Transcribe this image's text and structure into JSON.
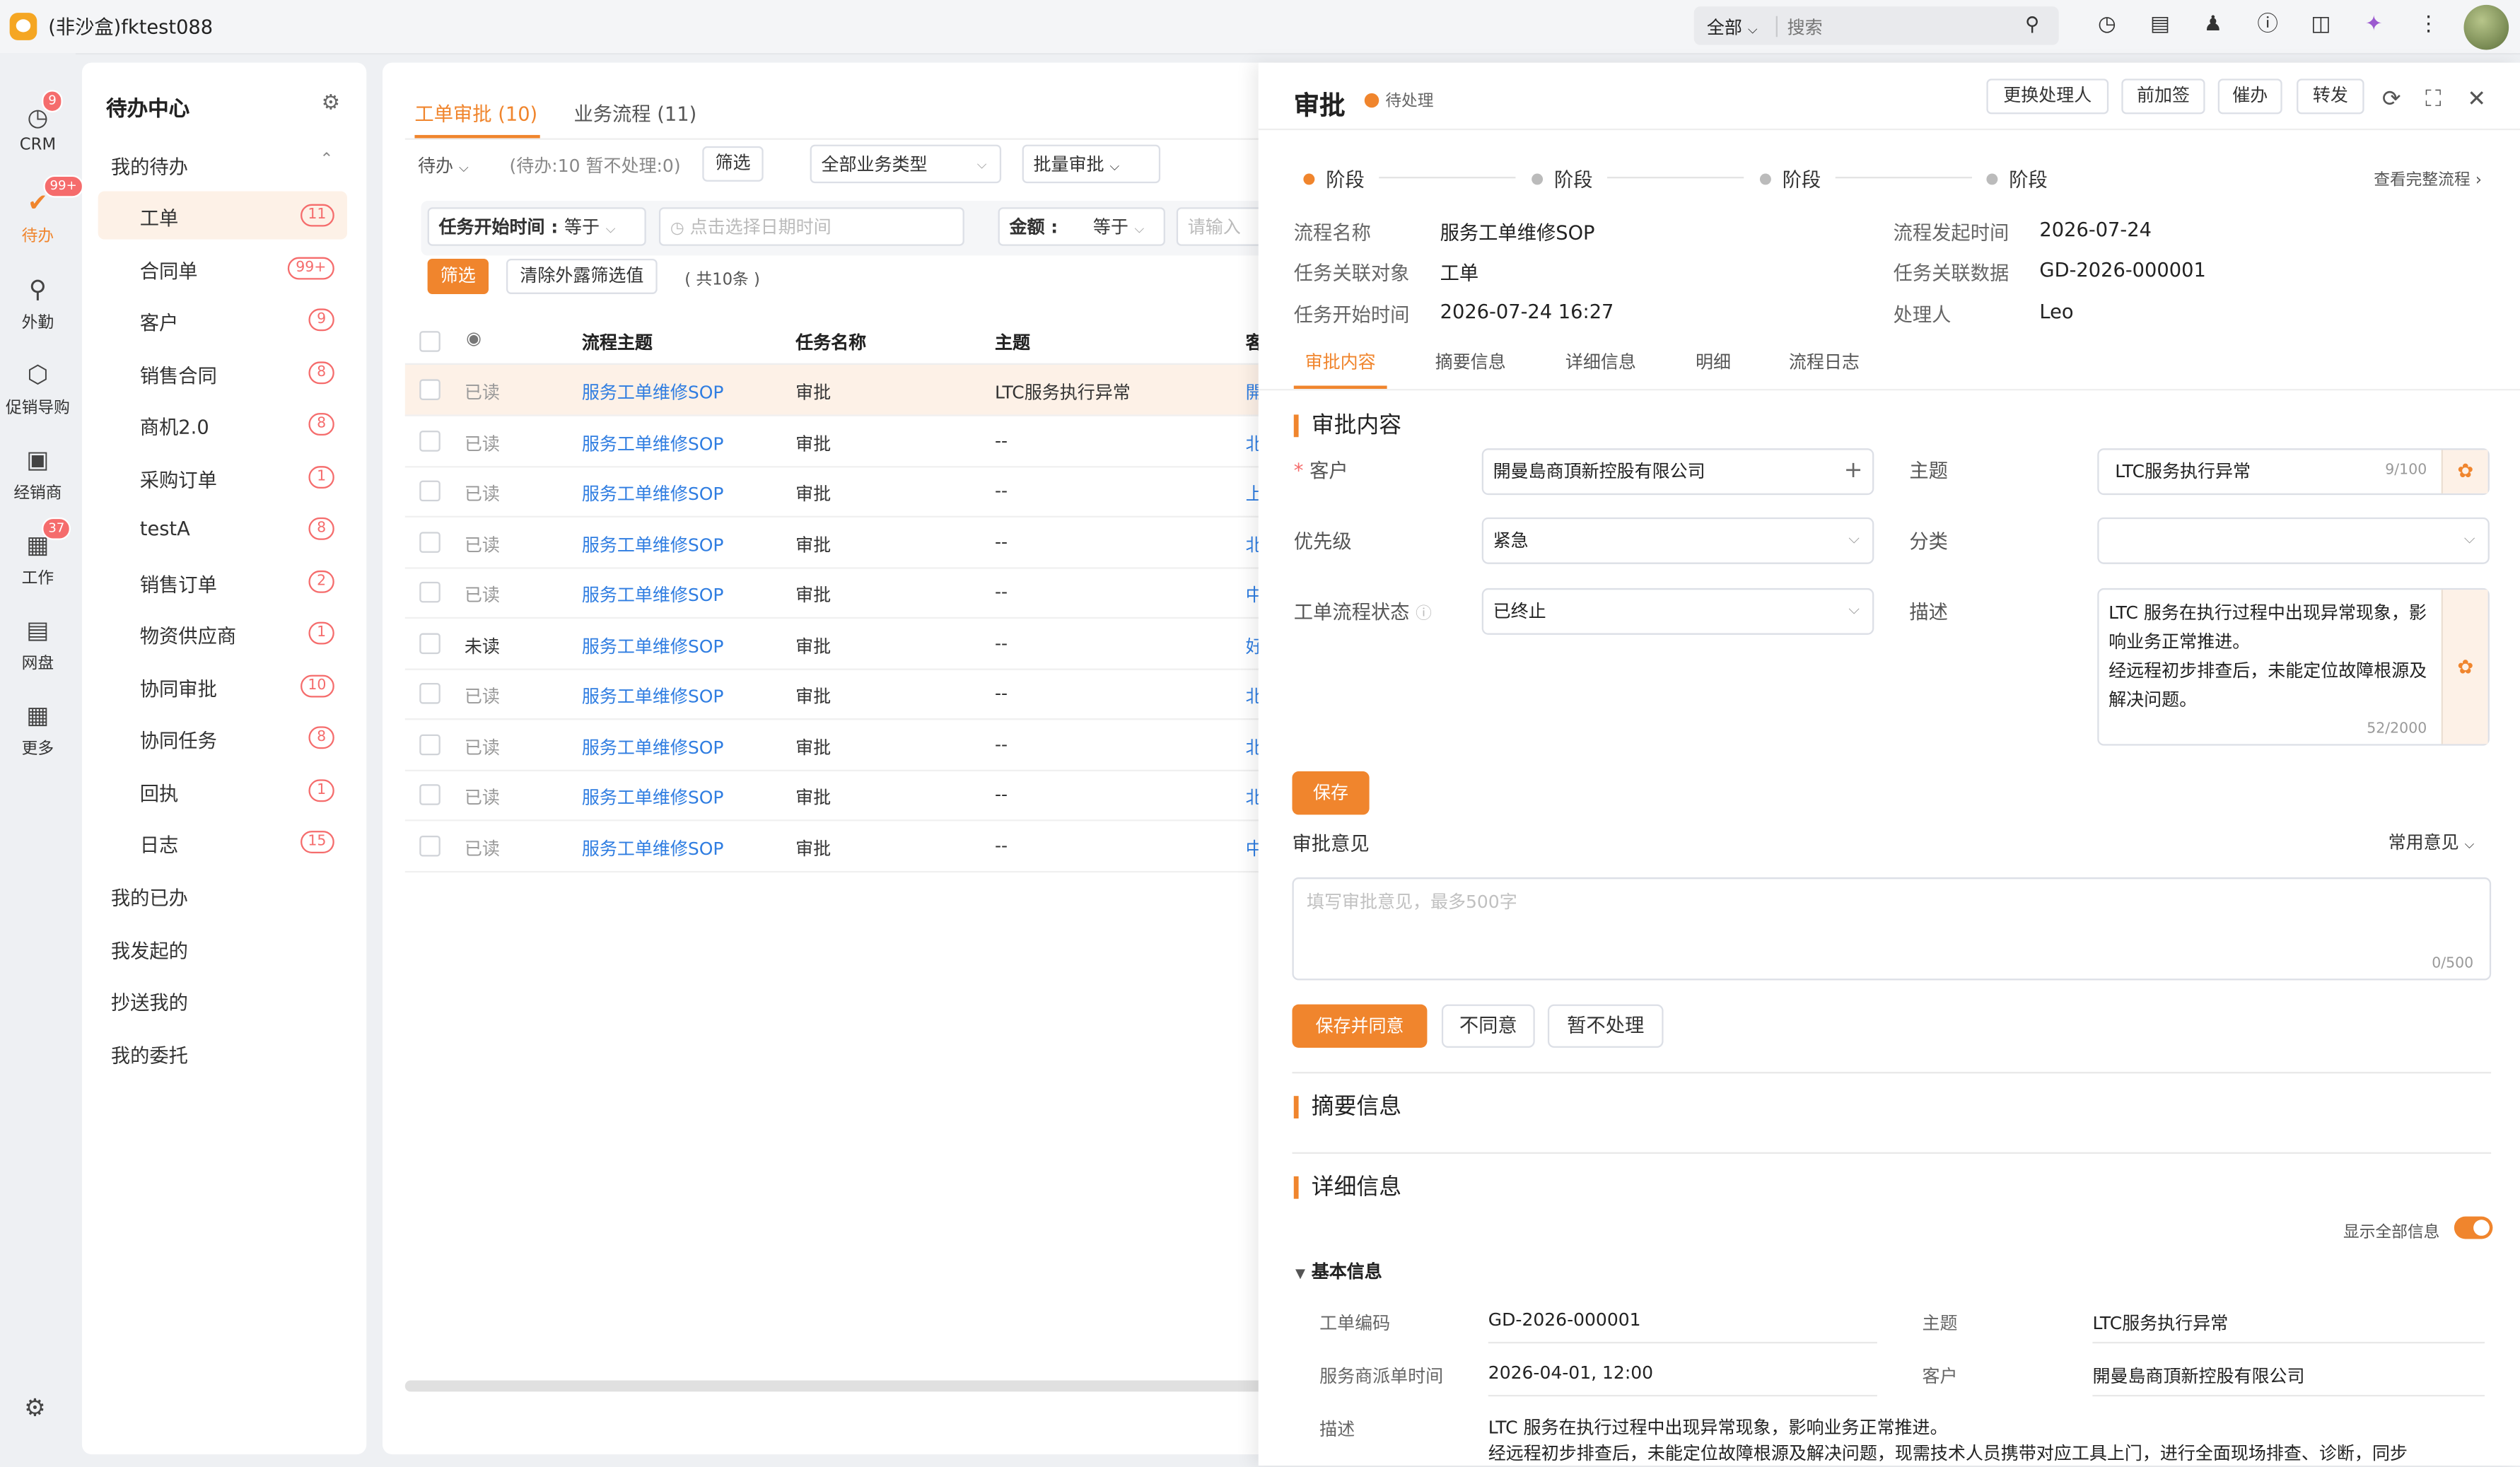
{
  "topbar": {
    "title": "(非沙盒)fktest088",
    "search_scope": "全部",
    "search_placeholder": "搜索"
  },
  "leftnav": [
    {
      "label": "CRM",
      "icon": "clock-icon",
      "badge": "9"
    },
    {
      "label": "待办",
      "icon": "check-circle-icon",
      "badge": "99+",
      "active": true
    },
    {
      "label": "外勤",
      "icon": "location-icon",
      "badge": ""
    },
    {
      "label": "促销导购",
      "icon": "cube-icon",
      "badge": ""
    },
    {
      "label": "经销商",
      "icon": "store-icon",
      "badge": ""
    },
    {
      "label": "工作",
      "icon": "calendar-icon",
      "badge": "37"
    },
    {
      "label": "网盘",
      "icon": "disk-icon",
      "badge": ""
    },
    {
      "label": "更多",
      "icon": "grid-icon",
      "badge": ""
    }
  ],
  "todo": {
    "title": "待办中心",
    "my_todo": "我的待办",
    "items": [
      {
        "label": "工单",
        "count": "11"
      },
      {
        "label": "合同单",
        "count": "99+"
      },
      {
        "label": "客户",
        "count": "9"
      },
      {
        "label": "销售合同",
        "count": "8"
      },
      {
        "label": "商机2.0",
        "count": "8"
      },
      {
        "label": "采购订单",
        "count": "1"
      },
      {
        "label": "testA",
        "count": "8"
      },
      {
        "label": "销售订单",
        "count": "2"
      },
      {
        "label": "物资供应商",
        "count": "1"
      },
      {
        "label": "协同审批",
        "count": "10"
      },
      {
        "label": "协同任务",
        "count": "8"
      },
      {
        "label": "回执",
        "count": "1"
      },
      {
        "label": "日志",
        "count": "15"
      }
    ],
    "done": "我的已办",
    "initiated": "我发起的",
    "cc": "抄送我的",
    "delegated": "我的委托"
  },
  "list": {
    "tab1": "工单审批 (10)",
    "tab2": "业务流程 (11)",
    "status_select": "待办",
    "status_info": "(待办:10 暂不处理:0)",
    "filter_btn": "筛选",
    "biz_type": "全部业务类型",
    "batch": "批量审批",
    "f_start_label": "任务开始时间 :",
    "f_start_op": "等于",
    "f_date_placeholder": "点击选择日期时间",
    "f_amount_label": "金额 :",
    "f_amount_op": "等于",
    "f_amount_placeholder": "请输入",
    "filter_apply": "筛选",
    "filter_clear": "清除外露筛选值",
    "total": "( 共10条 )",
    "headers": [
      "流程主题",
      "任务名称",
      "主题",
      "客"
    ],
    "rows": [
      {
        "read": "已读",
        "flow": "服务工单维修SOP",
        "task": "审批",
        "subject": "LTC服务执行异常",
        "cust": "開"
      },
      {
        "read": "已读",
        "flow": "服务工单维修SOP",
        "task": "审批",
        "subject": "--",
        "cust": "北"
      },
      {
        "read": "已读",
        "flow": "服务工单维修SOP",
        "task": "审批",
        "subject": "--",
        "cust": "上"
      },
      {
        "read": "已读",
        "flow": "服务工单维修SOP",
        "task": "审批",
        "subject": "--",
        "cust": "北"
      },
      {
        "read": "已读",
        "flow": "服务工单维修SOP",
        "task": "审批",
        "subject": "--",
        "cust": "中"
      },
      {
        "read": "未读",
        "flow": "服务工单维修SOP",
        "task": "审批",
        "subject": "--",
        "cust": "好"
      },
      {
        "read": "已读",
        "flow": "服务工单维修SOP",
        "task": "审批",
        "subject": "--",
        "cust": "北"
      },
      {
        "read": "已读",
        "flow": "服务工单维修SOP",
        "task": "审批",
        "subject": "--",
        "cust": "北"
      },
      {
        "read": "已读",
        "flow": "服务工单维修SOP",
        "task": "审批",
        "subject": "--",
        "cust": "北"
      },
      {
        "read": "已读",
        "flow": "服务工单维修SOP",
        "task": "审批",
        "subject": "--",
        "cust": "中"
      }
    ]
  },
  "detail": {
    "title": "审批",
    "status": "待处理",
    "btn_change": "更换处理人",
    "btn_presign": "前加签",
    "btn_urge": "催办",
    "btn_forward": "转发",
    "stages": [
      "阶段",
      "阶段",
      "阶段",
      "阶段"
    ],
    "view_flow": "查看完整流程",
    "info": {
      "flow_name_k": "流程名称",
      "flow_name_v": "服务工单维修SOP",
      "flow_start_k": "流程发起时间",
      "flow_start_v": "2026-07-24",
      "task_obj_k": "任务关联对象",
      "task_obj_v": "工单",
      "task_data_k": "任务关联数据",
      "task_data_v": "GD-2026-000001",
      "task_start_k": "任务开始时间",
      "task_start_v": "2026-07-24 16:27",
      "handler_k": "处理人",
      "handler_v": "Leo"
    },
    "tabs": [
      "审批内容",
      "摘要信息",
      "详细信息",
      "明细",
      "流程日志"
    ],
    "approval_section": "审批内容",
    "form": {
      "customer_label": "客户",
      "customer_value": "開曼島商頂新控股有限公司",
      "subject_label": "主题",
      "subject_value": "LTC服务执行异常",
      "subject_count": "9/100",
      "priority_label": "优先级",
      "priority_value": "紧急",
      "category_label": "分类",
      "category_value": "",
      "status_label": "工单流程状态",
      "status_value": "已终止",
      "desc_label": "描述",
      "desc_line1": "LTC 服务在执行过程中出现异常现象，影",
      "desc_line2": "响业务正常推进。",
      "desc_line3": "经远程初步排查后，未能定位故障根源及",
      "desc_line4": "解决问题。",
      "desc_count": "52/2000",
      "save": "保存"
    },
    "opinion_label": "审批意见",
    "common_opinion": "常用意见",
    "opinion_placeholder": "填写审批意见，最多500字",
    "opinion_count": "0/500",
    "btn_agree": "保存并同意",
    "btn_disagree": "不同意",
    "btn_hold": "暂不处理",
    "summary_section": "摘要信息",
    "detail_section": "详细信息",
    "show_all": "显示全部信息",
    "basic_info": "基本信息",
    "basic": {
      "code_k": "工单编码",
      "code_v": "GD-2026-000001",
      "subject_k": "主题",
      "subject_v": "LTC服务执行异常",
      "dispatch_k": "服务商派单时间",
      "dispatch_v": "2026-04-01, 12:00",
      "cust_k": "客户",
      "cust_v": "開曼島商頂新控股有限公司",
      "desc_k": "描述",
      "desc_v1": "LTC 服务在执行过程中出现异常现象，影响业务正常推进。",
      "desc_v2": "经远程初步排查后，未能定位故障根源及解决问题，现需技术人员携带对应工具上门，进行全面现场排查、诊断，同步"
    }
  },
  "colors": {
    "accent": "#f0852d",
    "link": "#2f7de1",
    "badge": "#f56c6c"
  }
}
